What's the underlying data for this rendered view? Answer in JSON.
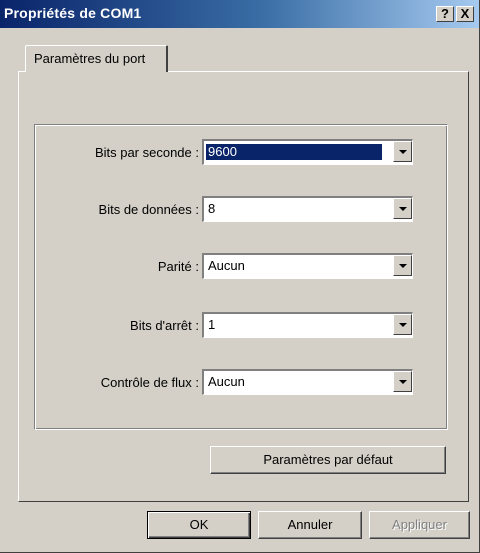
{
  "window": {
    "title": "Propriétés de COM1",
    "help_btn": "?",
    "close_btn": "X"
  },
  "tabs": [
    {
      "label": "Paramètres du port",
      "active": true
    }
  ],
  "fields": [
    {
      "label": "Bits par seconde :",
      "value": "9600",
      "selected": true
    },
    {
      "label": "Bits de données :",
      "value": "8"
    },
    {
      "label": "Parité :",
      "value": "Aucun"
    },
    {
      "label": "Bits d'arrêt :",
      "value": "1"
    },
    {
      "label": "Contrôle de flux :",
      "value": "Aucun"
    }
  ],
  "restore_defaults": "Paramètres par défaut",
  "footer": {
    "ok": "OK",
    "cancel": "Annuler",
    "apply": "Appliquer"
  },
  "colors": {
    "titlebar": "#0a246a",
    "face": "#d4d0c8",
    "selection": "#0a246a"
  },
  "icons": [
    "help-icon",
    "close-icon",
    "dropdown-arrow-icon"
  ]
}
